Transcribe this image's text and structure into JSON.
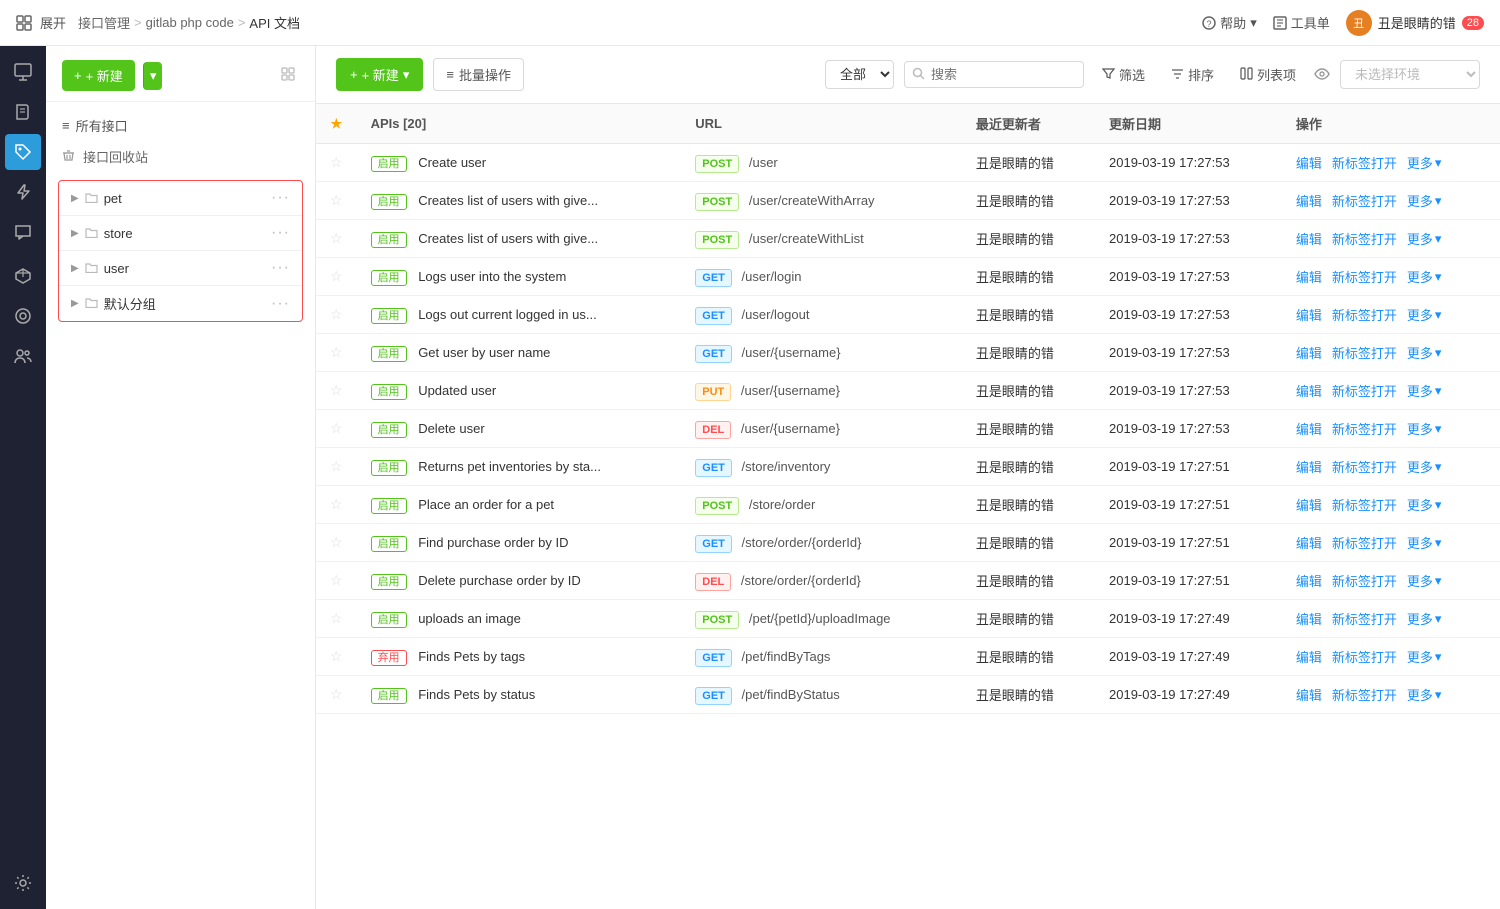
{
  "topbar": {
    "expand_label": "展开",
    "breadcrumb": [
      "接口管理",
      "gitlab php code",
      "API 文档"
    ],
    "help_label": "帮助",
    "tool_label": "工具单",
    "username": "丑是眼睛的错",
    "badge_count": "28"
  },
  "sidebar_icons": [
    {
      "name": "monitor-icon",
      "symbol": "⊞",
      "active": false
    },
    {
      "name": "book-icon",
      "symbol": "📖",
      "active": false
    },
    {
      "name": "tag-icon",
      "symbol": "🏷",
      "active": true
    },
    {
      "name": "lightning-icon",
      "symbol": "⚡",
      "active": false
    },
    {
      "name": "chat-icon",
      "symbol": "💬",
      "active": false
    },
    {
      "name": "box-icon",
      "symbol": "📦",
      "active": false
    },
    {
      "name": "layer-icon",
      "symbol": "◈",
      "active": false
    },
    {
      "name": "team-icon",
      "symbol": "👥",
      "active": false
    },
    {
      "name": "settings-icon",
      "symbol": "⚙",
      "active": false
    }
  ],
  "tree_panel": {
    "new_btn_label": "+ 新建",
    "all_interfaces_label": "所有接口",
    "recycle_label": "接口回收站",
    "groups": [
      {
        "name": "pet",
        "label": "pet"
      },
      {
        "name": "store",
        "label": "store"
      },
      {
        "name": "user",
        "label": "user"
      },
      {
        "name": "default",
        "label": "默认分组"
      }
    ]
  },
  "content_toolbar": {
    "new_btn_label": "+ 新建",
    "batch_label": "批量操作",
    "scope_all": "全部",
    "search_placeholder": "搜索",
    "filter_label": "筛选",
    "sort_label": "排序",
    "columns_label": "列表项",
    "env_placeholder": "未选择环境"
  },
  "table": {
    "columns": [
      "",
      "APIs [20]",
      "URL",
      "最近更新者",
      "更新日期",
      "操作"
    ],
    "rows": [
      {
        "starred": false,
        "status": "启用",
        "name": "Create user",
        "method": "POST",
        "url": "/user",
        "updater": "丑是眼睛的错",
        "date": "2019-03-19 17:27:53",
        "deprecated": false
      },
      {
        "starred": false,
        "status": "启用",
        "name": "Creates list of users with give...",
        "method": "POST",
        "url": "/user/createWithArray",
        "updater": "丑是眼睛的错",
        "date": "2019-03-19 17:27:53",
        "deprecated": false
      },
      {
        "starred": false,
        "status": "启用",
        "name": "Creates list of users with give...",
        "method": "POST",
        "url": "/user/createWithList",
        "updater": "丑是眼睛的错",
        "date": "2019-03-19 17:27:53",
        "deprecated": false
      },
      {
        "starred": false,
        "status": "启用",
        "name": "Logs user into the system",
        "method": "GET",
        "url": "/user/login",
        "updater": "丑是眼睛的错",
        "date": "2019-03-19 17:27:53",
        "deprecated": false
      },
      {
        "starred": false,
        "status": "启用",
        "name": "Logs out current logged in us...",
        "method": "GET",
        "url": "/user/logout",
        "updater": "丑是眼睛的错",
        "date": "2019-03-19 17:27:53",
        "deprecated": false
      },
      {
        "starred": false,
        "status": "启用",
        "name": "Get user by user name",
        "method": "GET",
        "url": "/user/{username}",
        "updater": "丑是眼睛的错",
        "date": "2019-03-19 17:27:53",
        "deprecated": false
      },
      {
        "starred": false,
        "status": "启用",
        "name": "Updated user",
        "method": "PUT",
        "url": "/user/{username}",
        "updater": "丑是眼睛的错",
        "date": "2019-03-19 17:27:53",
        "deprecated": false
      },
      {
        "starred": false,
        "status": "启用",
        "name": "Delete user",
        "method": "DEL",
        "url": "/user/{username}",
        "updater": "丑是眼睛的错",
        "date": "2019-03-19 17:27:53",
        "deprecated": false
      },
      {
        "starred": false,
        "status": "启用",
        "name": "Returns pet inventories by sta...",
        "method": "GET",
        "url": "/store/inventory",
        "updater": "丑是眼睛的错",
        "date": "2019-03-19 17:27:51",
        "deprecated": false
      },
      {
        "starred": false,
        "status": "启用",
        "name": "Place an order for a pet",
        "method": "POST",
        "url": "/store/order",
        "updater": "丑是眼睛的错",
        "date": "2019-03-19 17:27:51",
        "deprecated": false
      },
      {
        "starred": false,
        "status": "启用",
        "name": "Find purchase order by ID",
        "method": "GET",
        "url": "/store/order/{orderId}",
        "updater": "丑是眼睛的错",
        "date": "2019-03-19 17:27:51",
        "deprecated": false
      },
      {
        "starred": false,
        "status": "启用",
        "name": "Delete purchase order by ID",
        "method": "DEL",
        "url": "/store/order/{orderId}",
        "updater": "丑是眼睛的错",
        "date": "2019-03-19 17:27:51",
        "deprecated": false
      },
      {
        "starred": false,
        "status": "启用",
        "name": "uploads an image",
        "method": "POST",
        "url": "/pet/{petId}/uploadImage",
        "updater": "丑是眼睛的错",
        "date": "2019-03-19 17:27:49",
        "deprecated": false
      },
      {
        "starred": false,
        "status": "弃用",
        "name": "Finds Pets by tags",
        "method": "GET",
        "url": "/pet/findByTags",
        "updater": "丑是眼睛的错",
        "date": "2019-03-19 17:27:49",
        "deprecated": true
      },
      {
        "starred": false,
        "status": "启用",
        "name": "Finds Pets by status",
        "method": "GET",
        "url": "/pet/findByStatus",
        "updater": "丑是眼睛的错",
        "date": "2019-03-19 17:27:49",
        "deprecated": false
      }
    ],
    "actions": {
      "edit": "编辑",
      "new_tab": "新标签打开",
      "more": "更多"
    }
  },
  "colors": {
    "green": "#52c41a",
    "red": "#ff4d4f",
    "blue": "#1890ff",
    "icon_sidebar_bg": "#1f2233",
    "active_icon_bg": "#2d9cdb"
  }
}
